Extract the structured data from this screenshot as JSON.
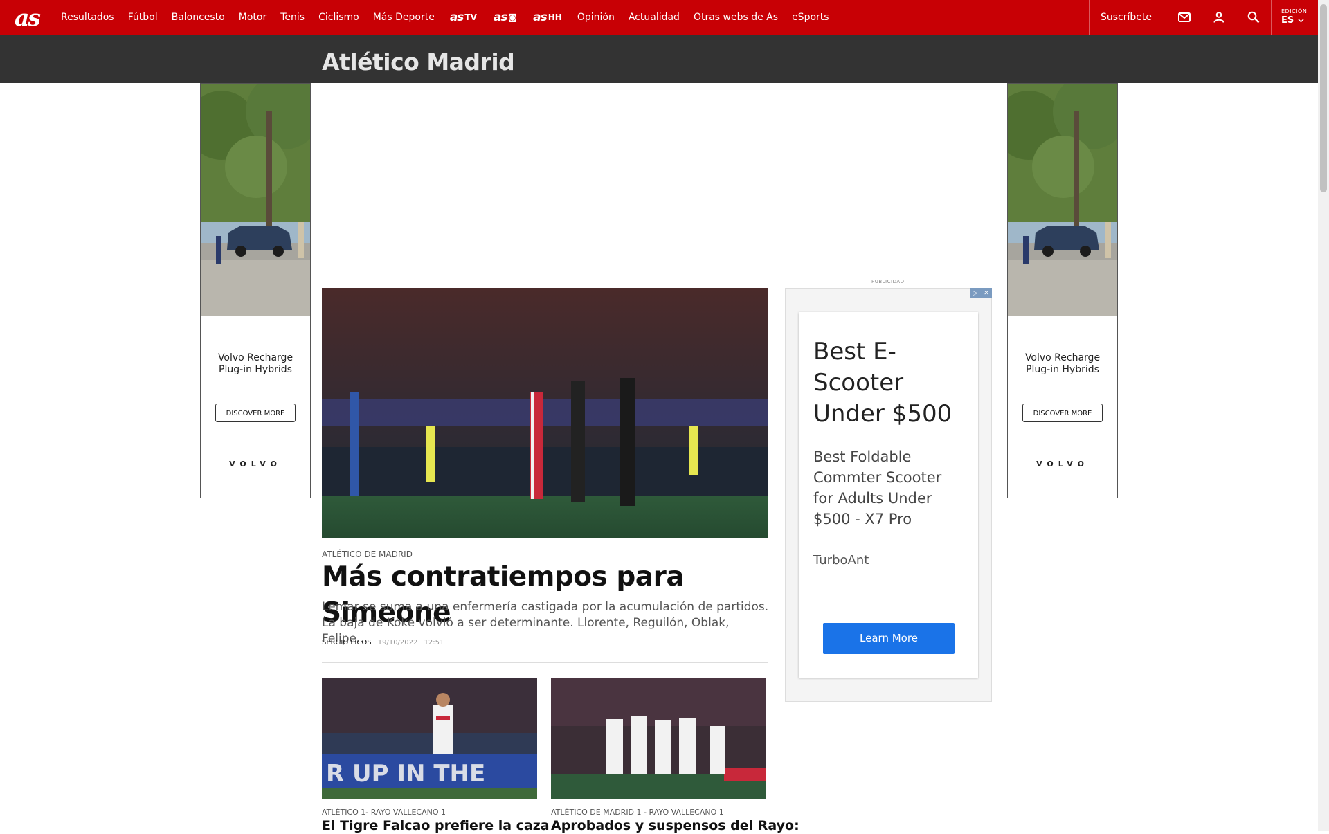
{
  "header": {
    "logo": "as",
    "nav": [
      "Resultados",
      "Fútbol",
      "Baloncesto",
      "Motor",
      "Tenis",
      "Ciclismo",
      "Más Deporte"
    ],
    "brands": [
      {
        "logo": "as",
        "suffix": "TV",
        "icon": "tv-icon"
      },
      {
        "logo": "as",
        "suffix": "◙",
        "icon": "camera-icon"
      },
      {
        "logo": "as",
        "suffix": "HH",
        "icon": "podcast-icon"
      }
    ],
    "nav2": [
      "Opinión",
      "Actualidad",
      "Otras webs de As",
      "eSports"
    ],
    "subscribe": "Suscríbete",
    "edition_label": "EDICIÓN",
    "edition_value": "ES"
  },
  "section": {
    "title": "Atlético Madrid"
  },
  "side_ad": {
    "title_line1": "Volvo Recharge",
    "title_line2": "Plug-in Hybrids",
    "button": "DISCOVER MORE",
    "brand": "VOLVO"
  },
  "main_story": {
    "kicker": "ATLÉTICO DE MADRID",
    "title": "Más contratiempos para Simeone",
    "lead": "Lemar se suma a una enfermería castigada por la acumulación de partidos. La baja de Koke volvió a ser determinante. Llorente, Reguilón, Oblak, Felipe...",
    "author": "SERGIO PICOS",
    "date": "19/10/2022",
    "time": "12:51"
  },
  "small_stories": [
    {
      "kicker": "ATLÉTICO 1- RAYO VALLECANO 1",
      "title": "El Tigre Falcao prefiere la caza"
    },
    {
      "kicker": "ATLÉTICO DE MADRID 1 - RAYO VALLECANO 1",
      "title": "Aprobados y suspensos del Rayo:"
    }
  ],
  "right_ad": {
    "label": "PUBLICIDAD",
    "headline": "Best E-Scooter Under $500",
    "body": "Best Foldable Commter Scooter for Adults Under $500 - X7 Pro",
    "advertiser": "TurboAnt",
    "cta": "Learn More"
  },
  "colors": {
    "brand_red": "#c80005",
    "section_bar": "#333333",
    "cta_blue": "#1a73e8"
  }
}
